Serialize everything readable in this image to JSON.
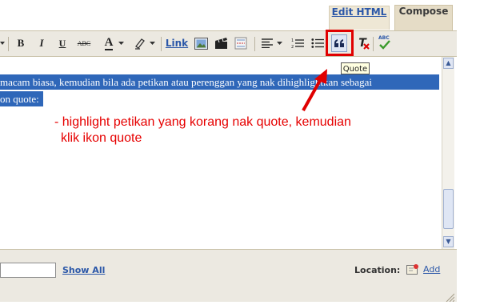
{
  "tabs": [
    {
      "label": "Edit HTML"
    },
    {
      "label": "Compose"
    }
  ],
  "toolbar": {
    "bold": "B",
    "italic": "I",
    "underline": "U",
    "strikethrough": "ABC",
    "text_color": "A",
    "link": "Link",
    "spellcheck": "ABC"
  },
  "editor": {
    "line1": "macam biasa, kemudian bila ada petikan atau perenggan yang nak dihighlightkan sebagai",
    "line2": "on quote:"
  },
  "annotation": {
    "line1": "- highlight petikan yang korang nak quote, kemudian",
    "line2": "klik ikon quote"
  },
  "tooltip": "Quote",
  "bottom": {
    "show_all": "Show All",
    "location_label": "Location:",
    "add": "Add"
  },
  "colors": {
    "accent_red": "#e00000",
    "selection_blue": "#2f67b9",
    "link_blue": "#2b57a8"
  }
}
